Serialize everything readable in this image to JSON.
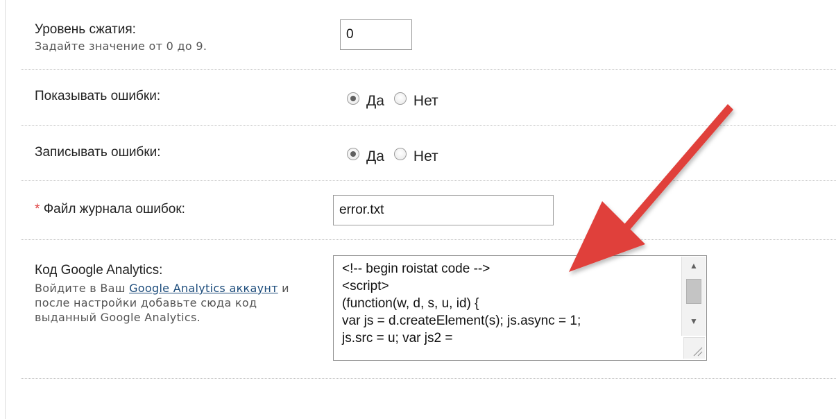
{
  "compression": {
    "label": "Уровень сжатия:",
    "hint": "Задайте значение от 0 до 9.",
    "value": "0"
  },
  "show_errors": {
    "label": "Показывать ошибки:",
    "yes_label": "Да",
    "no_label": "Нет",
    "selected": "yes"
  },
  "log_errors": {
    "label": "Записывать ошибки:",
    "yes_label": "Да",
    "no_label": "Нет",
    "selected": "yes"
  },
  "error_log_file": {
    "required_mark": "*",
    "label": "Файл журнала ошибок:",
    "value": "error.txt"
  },
  "google_analytics": {
    "label": "Код Google Analytics:",
    "hint_prefix": "Войдите в Ваш ",
    "hint_link": "Google Analytics аккаунт",
    "hint_suffix": " и после настройки добавьте сюда код выданный Google Analytics.",
    "code_lines": [
      "<!-- begin roistat code -->",
      "<script>",
      "(function(w, d, s, u, id) {",
      "var js = d.createElement(s); js.async = 1;",
      "js.src = u; var js2 ="
    ]
  },
  "colors": {
    "arrow": "#e0403a",
    "required": "#e04040",
    "link": "#1a4a7a"
  },
  "icons": {
    "arrow": "red-arrow-icon",
    "scroll_up": "scroll-up-icon",
    "scroll_down": "scroll-down-icon",
    "resize": "resize-grip-icon"
  }
}
